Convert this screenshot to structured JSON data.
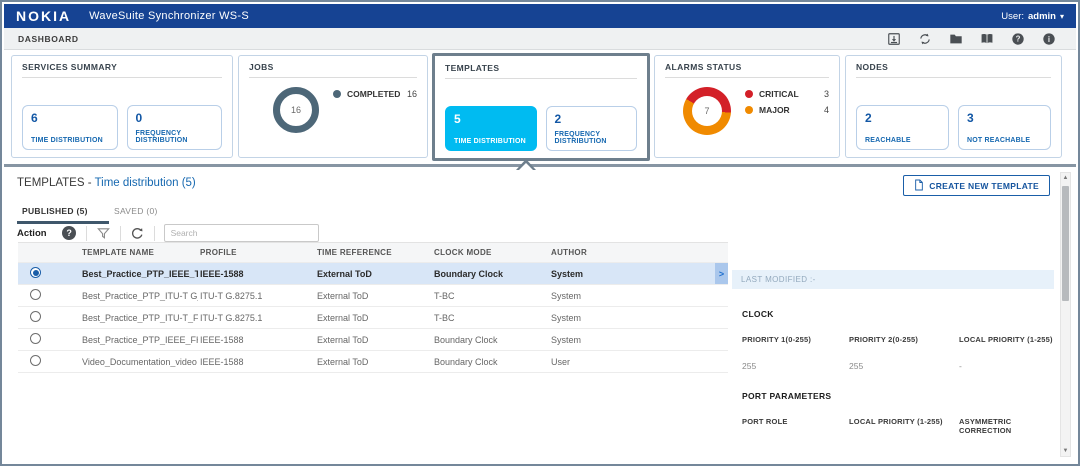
{
  "header": {
    "brand": "NOKIA",
    "app_title": "WaveSuite Synchronizer WS-S",
    "user_label": "User:",
    "user_name": "admin"
  },
  "nav": {
    "title": "DASHBOARD",
    "icons": [
      "import-icon",
      "sync-icon",
      "folder-icon",
      "book-icon",
      "help-icon",
      "info-icon"
    ]
  },
  "cards": {
    "services": {
      "title": "SERVICES SUMMARY",
      "tiles": [
        {
          "value": "6",
          "label": "TIME DISTRIBUTION"
        },
        {
          "value": "0",
          "label": "FREQUENCY DISTRIBUTION"
        }
      ]
    },
    "jobs": {
      "title": "JOBS",
      "donut_value": "16",
      "legend": [
        {
          "label": "COMPLETED",
          "value": "16",
          "color": "#4d6778"
        }
      ]
    },
    "templates": {
      "title": "TEMPLATES",
      "highlighted": true,
      "tiles": [
        {
          "value": "5",
          "label": "TIME DISTRIBUTION",
          "selected": true
        },
        {
          "value": "2",
          "label": "FREQUENCY DISTRIBUTION",
          "selected": false
        }
      ]
    },
    "alarms": {
      "title": "ALARMS STATUS",
      "donut_value": "7",
      "legend": [
        {
          "label": "CRITICAL",
          "value": "3",
          "color": "#d32028"
        },
        {
          "label": "MAJOR",
          "value": "4",
          "color": "#f08a00"
        }
      ]
    },
    "nodes": {
      "title": "NODES",
      "tiles": [
        {
          "value": "2",
          "label": "REACHABLE"
        },
        {
          "value": "3",
          "label": "NOT REACHABLE"
        }
      ]
    }
  },
  "templates_section": {
    "title_prefix": "TEMPLATES -",
    "title_link": "Time distribution (5)",
    "create_button": "CREATE NEW TEMPLATE",
    "tabs": [
      {
        "label": "PUBLISHED (5)",
        "active": true
      },
      {
        "label": "SAVED (0)",
        "active": false
      }
    ],
    "toolbar": {
      "action_label": "Action",
      "search_placeholder": "Search",
      "icons": [
        "help-icon",
        "filter-icon",
        "refresh-icon"
      ]
    },
    "table": {
      "columns": [
        "TEMPLATE NAME",
        "PROFILE",
        "TIME REFERENCE",
        "CLOCK MODE",
        "AUTHOR"
      ],
      "rows": [
        {
          "name": "Best_Practice_PTP_IEEE_Template",
          "profile": "IEEE-1588",
          "time_reference": "External ToD",
          "clock_mode": "Boundary Clock",
          "author": "System",
          "selected": true
        },
        {
          "name": "Best_Practice_PTP_ITU-T G_Templ",
          "profile": "ITU-T G.8275.1",
          "time_reference": "External ToD",
          "clock_mode": "T-BC",
          "author": "System",
          "selected": false
        },
        {
          "name": "Best_Practice_PTP_ITU-T_FH",
          "profile": "ITU-T G.8275.1",
          "time_reference": "External ToD",
          "clock_mode": "T-BC",
          "author": "System",
          "selected": false
        },
        {
          "name": "Best_Practice_PTP_IEEE_FH",
          "profile": "IEEE-1588",
          "time_reference": "External ToD",
          "clock_mode": "Boundary Clock",
          "author": "System",
          "selected": false
        },
        {
          "name": "Video_Documentation_video",
          "profile": "IEEE-1588",
          "time_reference": "External ToD",
          "clock_mode": "Boundary Clock",
          "author": "User",
          "selected": false
        }
      ]
    },
    "details": {
      "last_modified": "LAST MODIFIED :-",
      "clock_heading": "CLOCK",
      "clock_fields": [
        {
          "label": "PRIORITY 1(0-255)",
          "value": "255"
        },
        {
          "label": "PRIORITY 2(0-255)",
          "value": "255"
        },
        {
          "label": "LOCAL PRIORITY (1-255)",
          "value": "-"
        }
      ],
      "port_heading": "PORT PARAMETERS",
      "port_fields": [
        {
          "label": "PORT ROLE"
        },
        {
          "label": "LOCAL PRIORITY (1-255)"
        },
        {
          "label": "ASYMMETRIC CORRECTION"
        }
      ]
    }
  },
  "colors": {
    "header_blue": "#164393",
    "accent_blue": "#1668b0",
    "selected_cyan": "#00bbf1",
    "critical_red": "#d32028",
    "major_orange": "#f08a00",
    "jobs_slate": "#4d6778",
    "row_selected": "#d8e6f7",
    "highlight_border": "#6e7f8d"
  }
}
